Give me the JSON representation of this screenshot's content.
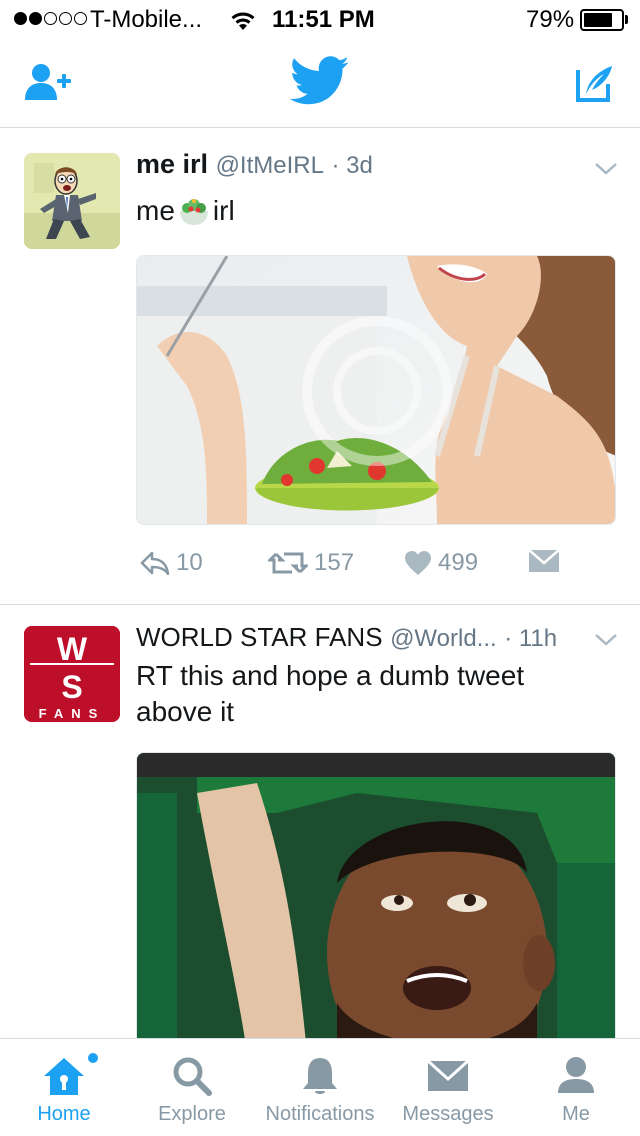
{
  "status_bar": {
    "carrier": "T-Mobile...",
    "time": "11:51 PM",
    "battery": "79%",
    "battery_level": 0.79
  },
  "nav": {
    "icons": [
      "add-user-icon",
      "twitter-bird-icon",
      "compose-tweet-icon"
    ]
  },
  "tweets": [
    {
      "name": "me irl",
      "handle": "@ItMeIRL",
      "time": "· 3d",
      "text": "me",
      "text_after_emoji": "irl",
      "emoji": "salad-emoji",
      "image": "woman-laughing-with-salad-photo",
      "replies": "10",
      "retweets": "157",
      "likes": "499"
    },
    {
      "name": "WORLD STAR FANS",
      "handle": "@World...",
      "time": "· 11h",
      "text": "RT this and hope a dumb tweet above it",
      "avatar_text": [
        "W",
        "S",
        "FANS"
      ],
      "image": "man-looking-up-photo"
    }
  ],
  "tabs": [
    {
      "label": "Home",
      "icon": "home-icon",
      "active": true
    },
    {
      "label": "Explore",
      "icon": "search-icon",
      "active": false
    },
    {
      "label": "Notifications",
      "icon": "bell-icon",
      "active": false
    },
    {
      "label": "Messages",
      "icon": "envelope-icon",
      "active": false
    },
    {
      "label": "Me",
      "icon": "person-icon",
      "active": false
    }
  ],
  "colors": {
    "accent": "#1da1f2",
    "muted": "#8899a6",
    "divider": "#d8dde2",
    "wsf_red": "#c8102e"
  }
}
